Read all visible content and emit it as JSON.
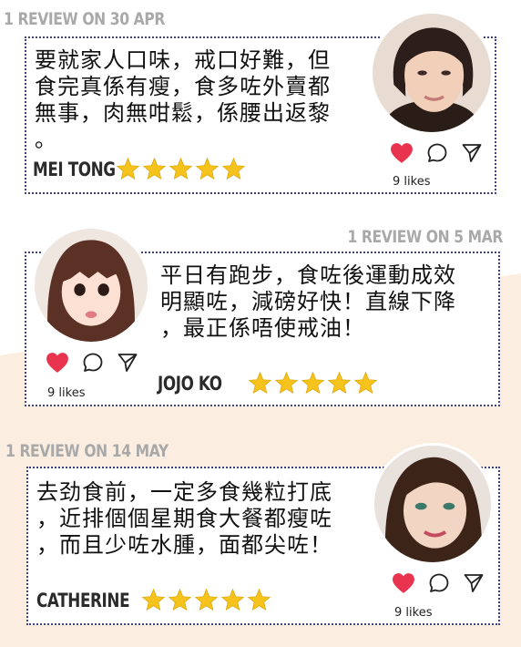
{
  "reviews": [
    {
      "heading": "1 REVIEW ON 30 APR",
      "text_lines": [
        "要就家人口味，戒口好難，但",
        "食完真係有瘦，食多咗外賣都",
        "無事，肉無咁鬆，係腰出返黎",
        "。"
      ],
      "name": "MEI TONG",
      "likes": "9 likes",
      "stars": 5
    },
    {
      "heading": "1 REVIEW ON 5 MAR",
      "text_lines": [
        "平日有跑步，食咗後運動成效",
        "明顯咗，減磅好快！直線下降",
        "，最正係唔使戒油！"
      ],
      "name": "JOJO KO",
      "likes": "9 likes",
      "stars": 5
    },
    {
      "heading": "1 REVIEW ON 14 MAY",
      "text_lines": [
        "去劲食前，一定多食幾粒打底",
        "，近排個個星期食大餐都瘦咗",
        "，而且少咗水腫，面都尖咗！"
      ],
      "name": "CATHERINE",
      "likes": "9 likes",
      "stars": 5
    }
  ],
  "icons": [
    "heart-icon",
    "comment-icon",
    "send-icon",
    "star-icon",
    "avatar-photo"
  ],
  "colors": {
    "border": "#3b3f8c",
    "heading": "#a9a9a9",
    "heart": "#e8344e",
    "star": "#f6c21c",
    "peach_bg": "#fbeee0"
  }
}
